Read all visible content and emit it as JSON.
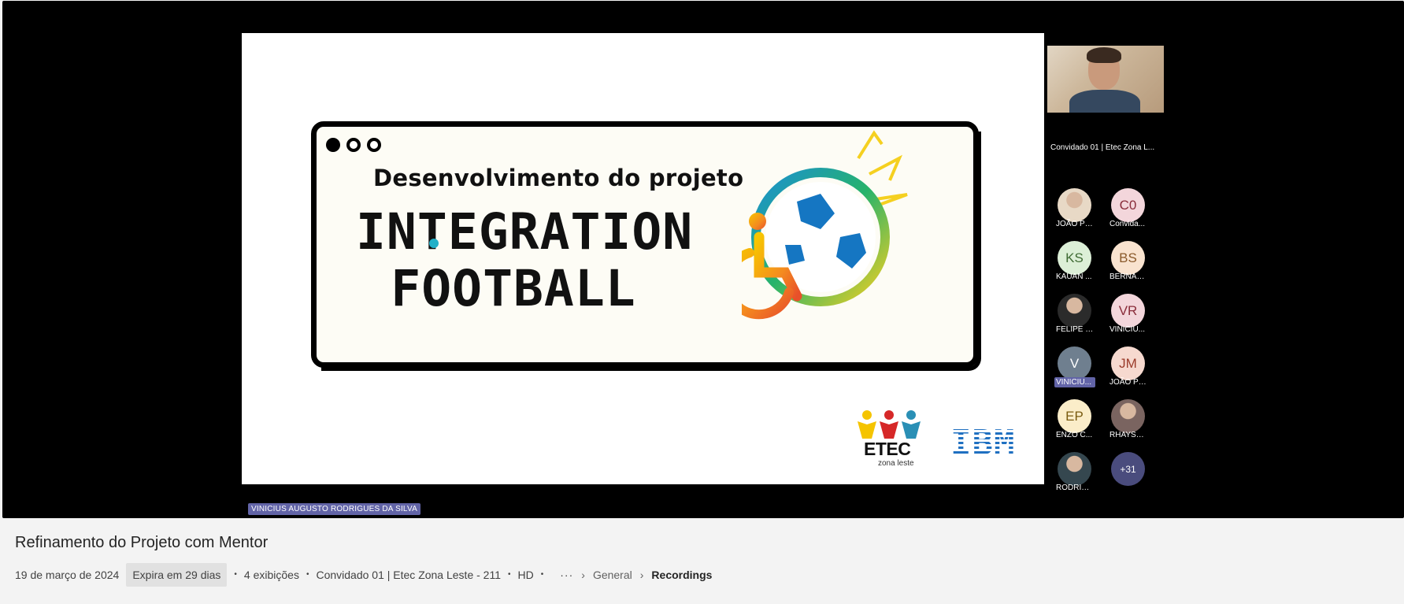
{
  "slide": {
    "subtitle": "Desenvolvimento do projeto",
    "title_line1": "INTEGRATION",
    "title_line2": "FOOTBALL",
    "logo_etec": "ETEC",
    "logo_etec_sub": "zona leste",
    "logo_ibm": "IBM"
  },
  "presenter_label": "VINICIUS AUGUSTO RODRIGUES DA SILVA",
  "camera": {
    "name": "Convidado 01 | Etec Zona L..."
  },
  "participants": [
    {
      "initials": "",
      "name": "JOÃO PE...",
      "bg": "#e8d9c6",
      "fg": "#6b4b2a",
      "photo": true
    },
    {
      "initials": "C0",
      "name": "Convida...",
      "bg": "#f3d6db",
      "fg": "#8a2d3b",
      "photo": false
    },
    {
      "initials": "KS",
      "name": "KAUAN ...",
      "bg": "#dcefd7",
      "fg": "#3f6b34",
      "photo": false
    },
    {
      "initials": "BS",
      "name": "BERNAR...",
      "bg": "#f9e3cf",
      "fg": "#8a5a2b",
      "photo": false
    },
    {
      "initials": "",
      "name": "FELIPE VI...",
      "bg": "#2b2b2b",
      "fg": "#fff",
      "photo": true
    },
    {
      "initials": "VR",
      "name": "VINICIU...",
      "bg": "#f3d6db",
      "fg": "#8a2d3b",
      "photo": false
    },
    {
      "initials": "V",
      "name": "VINICIU...",
      "bg": "#6f7f8f",
      "fg": "#fff",
      "photo": false,
      "active": true
    },
    {
      "initials": "JM",
      "name": "JOÃO PE...",
      "bg": "#f6d9cf",
      "fg": "#9a3b2a",
      "photo": false
    },
    {
      "initials": "EP",
      "name": "ENZO C...",
      "bg": "#fbedc9",
      "fg": "#7a5b10",
      "photo": false
    },
    {
      "initials": "",
      "name": "RHAYSS...",
      "bg": "#7a6460",
      "fg": "#fff",
      "photo": true
    },
    {
      "initials": "",
      "name": "RODRIG...",
      "bg": "#35474f",
      "fg": "#fff",
      "photo": true
    }
  ],
  "more_count": "+31",
  "recording": {
    "title": "Refinamento do Projeto com Mentor",
    "date": "19 de março de 2024",
    "expires": "Expira em 29 dias",
    "views": "4 exibições",
    "owner": "Convidado 01 | Etec Zona Leste - 211",
    "quality": "HD",
    "more": "···",
    "crumb_channel": "General",
    "crumb_folder": "Recordings"
  }
}
